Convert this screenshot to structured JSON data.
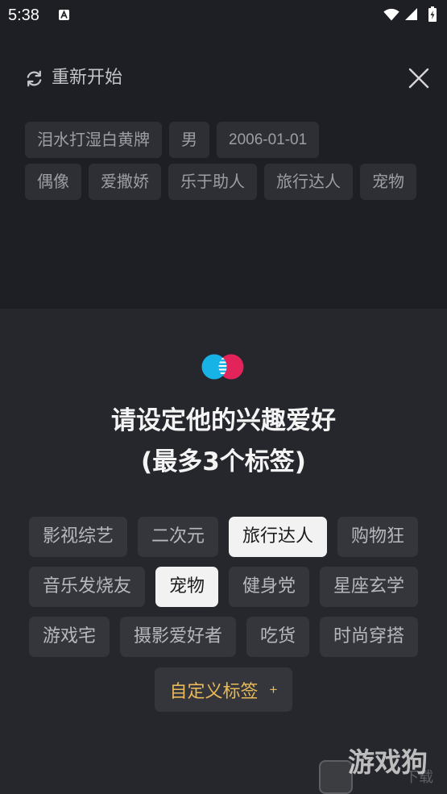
{
  "status_bar": {
    "time": "5:38",
    "notification_icon": "a-badge-icon",
    "wifi_icon": "wifi-icon",
    "signal_icon": "cell-signal-icon",
    "battery_icon": "battery-charging-icon"
  },
  "header": {
    "restart_icon": "refresh-icon",
    "restart_label": "重新开始",
    "close_icon": "close-icon"
  },
  "profile": {
    "summary_rows": [
      [
        "泪水打湿白黄牌",
        "男",
        "2006-01-01"
      ],
      [
        "偶像",
        "爱撒娇",
        "乐于助人",
        "旅行达人",
        "宠物"
      ]
    ]
  },
  "interest_panel": {
    "logo_icon": "app-logo-icon",
    "title_line1": "请设定他的兴趣爱好",
    "title_line2": "(最多3个标签)",
    "rows": [
      [
        {
          "label": "影视综艺",
          "selected": false
        },
        {
          "label": "二次元",
          "selected": false
        },
        {
          "label": "旅行达人",
          "selected": true
        },
        {
          "label": "购物狂",
          "selected": false
        }
      ],
      [
        {
          "label": "音乐发烧友",
          "selected": false
        },
        {
          "label": "宠物",
          "selected": true
        },
        {
          "label": "健身党",
          "selected": false
        },
        {
          "label": "星座玄学",
          "selected": false
        }
      ],
      [
        {
          "label": "游戏宅",
          "selected": false
        },
        {
          "label": "摄影爱好者",
          "selected": false
        },
        {
          "label": "吃货",
          "selected": false
        },
        {
          "label": "时尚穿搭",
          "selected": false
        }
      ]
    ],
    "custom_tag": {
      "label": "自定义标签",
      "plus": "+"
    }
  },
  "colors": {
    "background": "#1e1f24",
    "panel": "#26272c",
    "chip": "#35363b",
    "chip_selected": "#f2f2f2",
    "accent_gold": "#e9b95a",
    "logo_blue": "#18b3e6",
    "logo_pink": "#e3245b"
  },
  "watermark": {
    "brand": "游戏狗",
    "sub": "下载"
  }
}
